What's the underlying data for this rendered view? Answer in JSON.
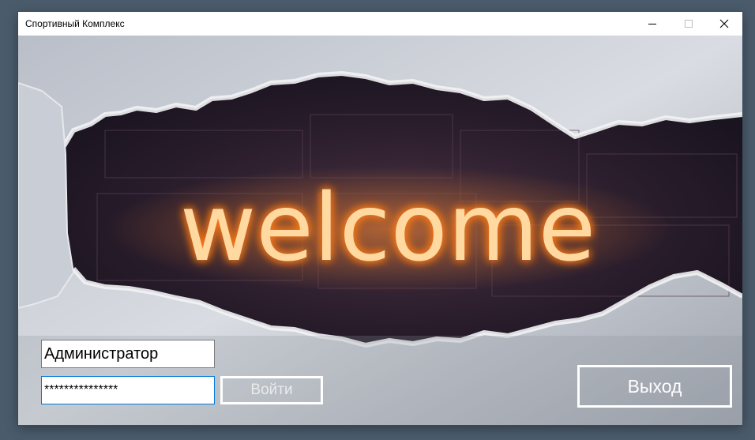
{
  "window": {
    "title": "Спортивный Комплекс"
  },
  "banner": {
    "text": "welcome",
    "glow_color": "#ffb04a"
  },
  "login": {
    "username_value": "Администратор",
    "password_value": "***************",
    "login_label": "Войти",
    "exit_label": "Выход"
  },
  "icons": {
    "minimize": "minimize-icon",
    "maximize": "maximize-icon",
    "close": "close-icon"
  }
}
